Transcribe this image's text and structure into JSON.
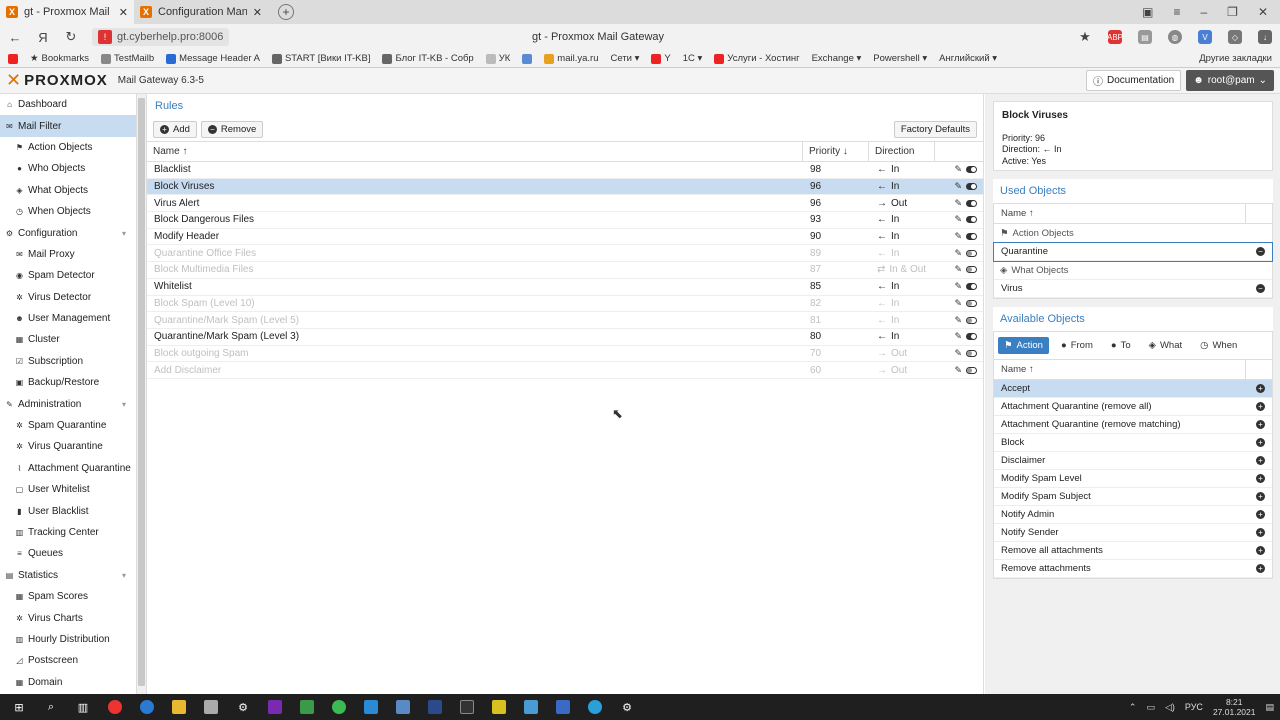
{
  "browser": {
    "tabs": [
      {
        "title": "gt - Proxmox Mail Gate",
        "active": true
      },
      {
        "title": "Configuration Managem",
        "active": false
      }
    ],
    "url": "gt.cyberhelp.pro:8006",
    "page_title": "gt - Proxmox Mail Gateway",
    "bookmarks": [
      "Bookmarks",
      "TestMailb",
      "Message Header A",
      "START [Вики IT-KB]",
      "Блог IT-KB - Собр",
      "УК",
      "mail.ya.ru",
      "Сети ▾",
      "Y",
      "1С ▾",
      "Услуги - Хостинг",
      "Exchange ▾",
      "Powershell ▾",
      "Английский ▾"
    ],
    "other_bookmarks": "Другие закладки"
  },
  "app": {
    "logo_text": "PROXMOX",
    "version": "Mail Gateway 6.3-5",
    "documentation_label": "Documentation",
    "user_label": "root@pam"
  },
  "nav": [
    {
      "label": "Dashboard",
      "level": 0,
      "icon": "⌂"
    },
    {
      "label": "Mail Filter",
      "level": 0,
      "icon": "✉",
      "selected": true
    },
    {
      "label": "Action Objects",
      "level": 1,
      "icon": "⚑"
    },
    {
      "label": "Who Objects",
      "level": 1,
      "icon": "●"
    },
    {
      "label": "What Objects",
      "level": 1,
      "icon": "◈"
    },
    {
      "label": "When Objects",
      "level": 1,
      "icon": "◷"
    },
    {
      "label": "Configuration",
      "level": 0,
      "icon": "⚙",
      "collapsible": true
    },
    {
      "label": "Mail Proxy",
      "level": 1,
      "icon": "✉"
    },
    {
      "label": "Spam Detector",
      "level": 1,
      "icon": "◉"
    },
    {
      "label": "Virus Detector",
      "level": 1,
      "icon": "✲"
    },
    {
      "label": "User Management",
      "level": 1,
      "icon": "☻"
    },
    {
      "label": "Cluster",
      "level": 1,
      "icon": "▦"
    },
    {
      "label": "Subscription",
      "level": 1,
      "icon": "☑"
    },
    {
      "label": "Backup/Restore",
      "level": 1,
      "icon": "▣"
    },
    {
      "label": "Administration",
      "level": 0,
      "icon": "✎",
      "collapsible": true
    },
    {
      "label": "Spam Quarantine",
      "level": 1,
      "icon": "✲"
    },
    {
      "label": "Virus Quarantine",
      "level": 1,
      "icon": "✲"
    },
    {
      "label": "Attachment Quarantine",
      "level": 1,
      "icon": "⌇"
    },
    {
      "label": "User Whitelist",
      "level": 1,
      "icon": "▢"
    },
    {
      "label": "User Blacklist",
      "level": 1,
      "icon": "▮"
    },
    {
      "label": "Tracking Center",
      "level": 1,
      "icon": "▥"
    },
    {
      "label": "Queues",
      "level": 1,
      "icon": "≡"
    },
    {
      "label": "Statistics",
      "level": 0,
      "icon": "▤",
      "collapsible": true
    },
    {
      "label": "Spam Scores",
      "level": 1,
      "icon": "▦"
    },
    {
      "label": "Virus Charts",
      "level": 1,
      "icon": "✲"
    },
    {
      "label": "Hourly Distribution",
      "level": 1,
      "icon": "▥"
    },
    {
      "label": "Postscreen",
      "level": 1,
      "icon": "◿"
    },
    {
      "label": "Domain",
      "level": 1,
      "icon": "▦"
    }
  ],
  "rules_panel": {
    "title": "Rules",
    "add_label": "Add",
    "remove_label": "Remove",
    "factory_label": "Factory Defaults",
    "columns": {
      "name": "Name ↑",
      "priority": "Priority ↓",
      "direction": "Direction"
    },
    "rows": [
      {
        "name": "Blacklist",
        "priority": "98",
        "direction": "In",
        "arrow": "←",
        "active": true
      },
      {
        "name": "Block Viruses",
        "priority": "96",
        "direction": "In",
        "arrow": "←",
        "active": true,
        "selected": true
      },
      {
        "name": "Virus Alert",
        "priority": "96",
        "direction": "Out",
        "arrow": "→",
        "active": true
      },
      {
        "name": "Block Dangerous Files",
        "priority": "93",
        "direction": "In",
        "arrow": "←",
        "active": true
      },
      {
        "name": "Modify Header",
        "priority": "90",
        "direction": "In",
        "arrow": "←",
        "active": true
      },
      {
        "name": "Quarantine Office Files",
        "priority": "89",
        "direction": "In",
        "arrow": "←",
        "active": false
      },
      {
        "name": "Block Multimedia Files",
        "priority": "87",
        "direction": "In & Out",
        "arrow": "⇄",
        "active": false
      },
      {
        "name": "Whitelist",
        "priority": "85",
        "direction": "In",
        "arrow": "←",
        "active": true
      },
      {
        "name": "Block Spam (Level 10)",
        "priority": "82",
        "direction": "In",
        "arrow": "←",
        "active": false
      },
      {
        "name": "Quarantine/Mark Spam (Level 5)",
        "priority": "81",
        "direction": "In",
        "arrow": "←",
        "active": false
      },
      {
        "name": "Quarantine/Mark Spam (Level 3)",
        "priority": "80",
        "direction": "In",
        "arrow": "←",
        "active": true
      },
      {
        "name": "Block outgoing Spam",
        "priority": "70",
        "direction": "Out",
        "arrow": "→",
        "active": false
      },
      {
        "name": "Add Disclaimer",
        "priority": "60",
        "direction": "Out",
        "arrow": "→",
        "active": false
      }
    ]
  },
  "detail": {
    "title": "Block Viruses",
    "priority": "Priority: 96",
    "direction_prefix": "Direction:",
    "direction_arrow": "←",
    "direction_value": "In",
    "active": "Active: Yes"
  },
  "used_objects": {
    "title": "Used Objects",
    "column": "Name ↑",
    "groups": [
      {
        "label": "Action Objects",
        "icon": "⚑",
        "items": [
          "Quarantine"
        ]
      },
      {
        "label": "What Objects",
        "icon": "◈",
        "items": [
          "Virus"
        ]
      }
    ]
  },
  "available_objects": {
    "title": "Available Objects",
    "tabs": [
      {
        "label": "Action",
        "icon": "⚑",
        "active": true
      },
      {
        "label": "From",
        "icon": "●"
      },
      {
        "label": "To",
        "icon": "●"
      },
      {
        "label": "What",
        "icon": "◈"
      },
      {
        "label": "When",
        "icon": "◷"
      }
    ],
    "column": "Name ↑",
    "items": [
      "Accept",
      "Attachment Quarantine (remove all)",
      "Attachment Quarantine (remove matching)",
      "Block",
      "Disclaimer",
      "Modify Spam Level",
      "Modify Spam Subject",
      "Notify Admin",
      "Notify Sender",
      "Remove all attachments",
      "Remove attachments"
    ]
  },
  "taskbar": {
    "lang": "РУС",
    "time": "8:21",
    "date": "27.01.2021"
  }
}
